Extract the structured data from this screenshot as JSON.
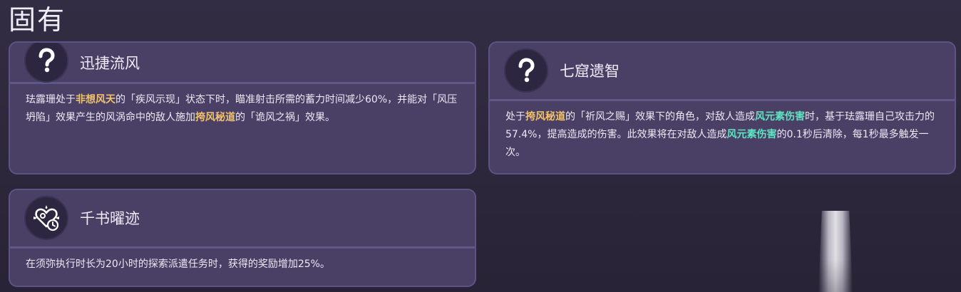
{
  "section": {
    "title": "固有"
  },
  "cards": [
    {
      "name": "迅捷流风",
      "icon": "question-mark-icon",
      "segments": [
        {
          "t": "珐露珊处于",
          "c": ""
        },
        {
          "t": "非想风天",
          "c": "gold"
        },
        {
          "t": "的「疾风示现」状态下时，瞄准射击所需的蓄力时间减少60%，并能对「风压坍陷」效果产生的风涡命中的敌人施加",
          "c": ""
        },
        {
          "t": "挎风秘道",
          "c": "gold"
        },
        {
          "t": "的「诡风之祸」效果。",
          "c": ""
        }
      ]
    },
    {
      "name": "七窟遗智",
      "icon": "question-mark-icon",
      "segments": [
        {
          "t": "处于",
          "c": ""
        },
        {
          "t": "挎风秘道",
          "c": "gold"
        },
        {
          "t": "的「祈风之赐」效果下的角色，对敌人造成",
          "c": ""
        },
        {
          "t": "风元素伤害",
          "c": "green"
        },
        {
          "t": "时，基于珐露珊自己攻击力的57.4%，提高造成的伤害。此效果将在对敌人造成",
          "c": ""
        },
        {
          "t": "风元素伤害",
          "c": "green"
        },
        {
          "t": "的0.1秒后清除，每1秒最多触发一次。",
          "c": ""
        }
      ]
    },
    {
      "name": "千书曜迹",
      "icon": "expedition-compass-icon",
      "segments": [
        {
          "t": "在须弥执行时长为20小时的探索派遣任务时，获得的奖励增加25%。",
          "c": ""
        }
      ]
    }
  ],
  "colors": {
    "highlight_gold": "#f1c26a",
    "highlight_green": "#5fe3c0",
    "card_bg": "#4a4066",
    "card_border": "#5d5384"
  }
}
